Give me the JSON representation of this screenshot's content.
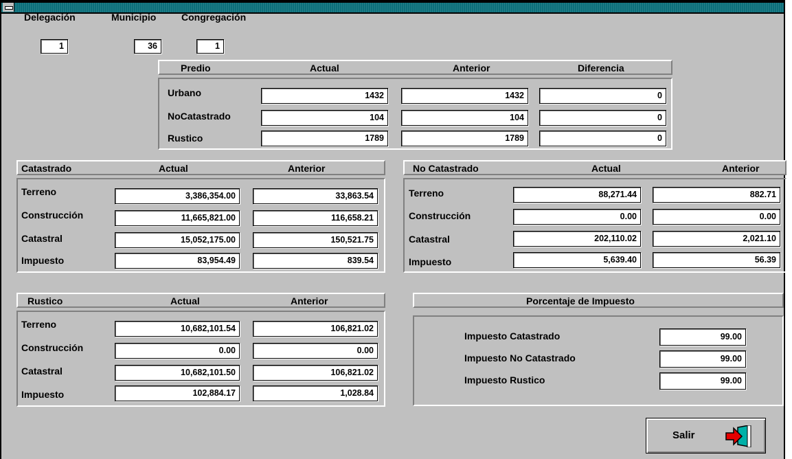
{
  "header": {
    "delegacion_label": "Delegación",
    "municipio_label": "Municipio",
    "congregacion_label": "Congregación",
    "delegacion_value": "1",
    "municipio_value": "36",
    "congregacion_value": "1"
  },
  "predio": {
    "headers": [
      "Predio",
      "Actual",
      "Anterior",
      "Diferencia"
    ],
    "rows": [
      {
        "label": "Urbano",
        "actual": "1432",
        "anterior": "1432",
        "diferencia": "0"
      },
      {
        "label": "NoCatastrado",
        "actual": "104",
        "anterior": "104",
        "diferencia": "0"
      },
      {
        "label": "Rustico",
        "actual": "1789",
        "anterior": "1789",
        "diferencia": "0"
      }
    ]
  },
  "catastrado": {
    "headers": [
      "Catastrado",
      "Actual",
      "Anterior"
    ],
    "rows": [
      {
        "label": "Terreno",
        "actual": "3,386,354.00",
        "anterior": "33,863.54"
      },
      {
        "label": "Construcción",
        "actual": "11,665,821.00",
        "anterior": "116,658.21"
      },
      {
        "label": "Catastral",
        "actual": "15,052,175.00",
        "anterior": "150,521.75"
      },
      {
        "label": "Impuesto",
        "actual": "83,954.49",
        "anterior": "839.54"
      }
    ]
  },
  "no_catastrado": {
    "headers": [
      "No Catastrado",
      "Actual",
      "Anterior"
    ],
    "rows": [
      {
        "label": "Terreno",
        "actual": "88,271.44",
        "anterior": "882.71"
      },
      {
        "label": "Construcción",
        "actual": "0.00",
        "anterior": "0.00"
      },
      {
        "label": "Catastral",
        "actual": "202,110.02",
        "anterior": "2,021.10"
      },
      {
        "label": "Impuesto",
        "actual": "5,639.40",
        "anterior": "56.39"
      }
    ]
  },
  "rustico": {
    "headers": [
      "Rustico",
      "Actual",
      "Anterior"
    ],
    "rows": [
      {
        "label": "Terreno",
        "actual": "10,682,101.54",
        "anterior": "106,821.02"
      },
      {
        "label": "Construcción",
        "actual": "0.00",
        "anterior": "0.00"
      },
      {
        "label": "Catastral",
        "actual": "10,682,101.50",
        "anterior": "106,821.02"
      },
      {
        "label": "Impuesto",
        "actual": "102,884.17",
        "anterior": "1,028.84"
      }
    ]
  },
  "porcentaje": {
    "title": "Porcentaje de Impuesto",
    "rows": [
      {
        "label": "Impuesto Catastrado",
        "value": "99.00"
      },
      {
        "label": "Impuesto No Catastrado",
        "value": "99.00"
      },
      {
        "label": "Impuesto Rustico",
        "value": "99.00"
      }
    ]
  },
  "salir_label": "Salir",
  "icons": {
    "sysmenu": "system-menu-icon",
    "exit": "exit-door-icon"
  },
  "colors": {
    "titlebar": "#0c6f7a",
    "window": "#c0c0c0",
    "exit_arrow": "#e60000",
    "door": "#00b0a8"
  }
}
